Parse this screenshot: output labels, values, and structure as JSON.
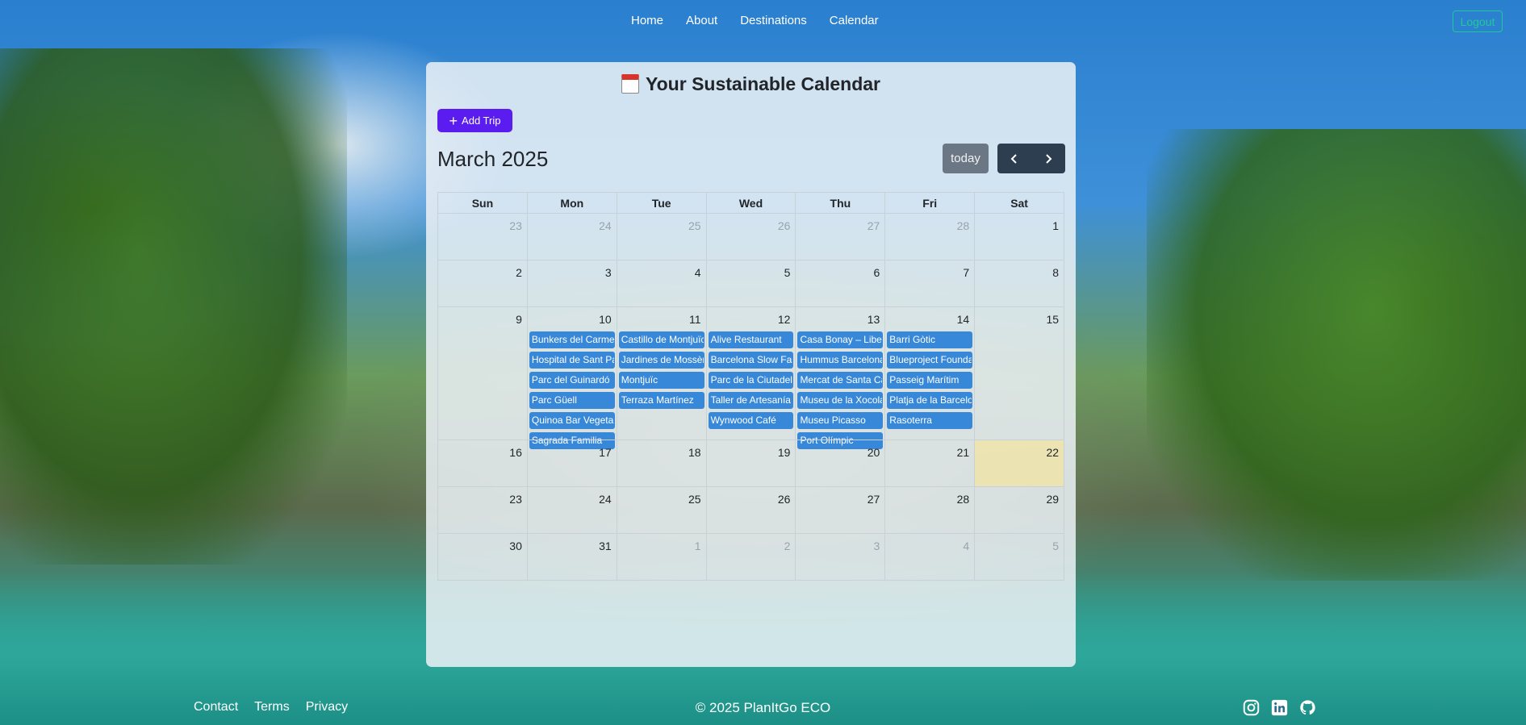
{
  "nav": {
    "links": [
      "Home",
      "About",
      "Destinations",
      "Calendar"
    ],
    "logout": "Logout"
  },
  "card": {
    "title": "Your Sustainable Calendar",
    "add_trip": "Add Trip",
    "month": "March 2025",
    "today": "today"
  },
  "calendar": {
    "weekdays": [
      "Sun",
      "Mon",
      "Tue",
      "Wed",
      "Thu",
      "Fri",
      "Sat"
    ],
    "weeks": [
      [
        {
          "n": "23",
          "other": true
        },
        {
          "n": "24",
          "other": true
        },
        {
          "n": "25",
          "other": true
        },
        {
          "n": "26",
          "other": true
        },
        {
          "n": "27",
          "other": true
        },
        {
          "n": "28",
          "other": true
        },
        {
          "n": "1"
        }
      ],
      [
        {
          "n": "2"
        },
        {
          "n": "3"
        },
        {
          "n": "4"
        },
        {
          "n": "5"
        },
        {
          "n": "6"
        },
        {
          "n": "7"
        },
        {
          "n": "8"
        }
      ],
      [
        {
          "n": "9"
        },
        {
          "n": "10",
          "events": [
            "Bunkers del Carmel",
            "Hospital de Sant Pau",
            "Parc del Guinardó",
            "Parc Güell",
            "Quinoa Bar Vegetariano",
            "Sagrada Familia"
          ]
        },
        {
          "n": "11",
          "events": [
            "Castillo de Montjuïc",
            "Jardines de Mossèn",
            "Montjuïc",
            "Terraza Martínez"
          ]
        },
        {
          "n": "12",
          "events": [
            "Alive Restaurant",
            "Barcelona Slow Fashion",
            "Parc de la Ciutadella",
            "Taller de Artesanía",
            "Wynwood Café"
          ]
        },
        {
          "n": "13",
          "events": [
            "Casa Bonay – Libertine",
            "Hummus Barcelona",
            "Mercat de Santa Caterina",
            "Museu de la Xocolata",
            "Museu Picasso",
            "Port Olímpic"
          ]
        },
        {
          "n": "14",
          "events": [
            "Barri Gòtic",
            "Blueproject Foundation",
            "Passeig Marítim",
            "Platja de la Barceloneta",
            "Rasoterra"
          ]
        },
        {
          "n": "15"
        }
      ],
      [
        {
          "n": "16"
        },
        {
          "n": "17"
        },
        {
          "n": "18"
        },
        {
          "n": "19"
        },
        {
          "n": "20"
        },
        {
          "n": "21"
        },
        {
          "n": "22",
          "today": true
        }
      ],
      [
        {
          "n": "23"
        },
        {
          "n": "24"
        },
        {
          "n": "25"
        },
        {
          "n": "26"
        },
        {
          "n": "27"
        },
        {
          "n": "28"
        },
        {
          "n": "29"
        }
      ],
      [
        {
          "n": "30"
        },
        {
          "n": "31"
        },
        {
          "n": "1",
          "other": true
        },
        {
          "n": "2",
          "other": true
        },
        {
          "n": "3",
          "other": true
        },
        {
          "n": "4",
          "other": true
        },
        {
          "n": "5",
          "other": true
        }
      ]
    ]
  },
  "footer": {
    "links": [
      "Contact",
      "Terms",
      "Privacy"
    ],
    "copyright": "© 2025 PlanItGo ECO",
    "social": [
      "instagram-icon",
      "linkedin-icon",
      "github-icon"
    ]
  },
  "colors": {
    "event": "#3788d8",
    "add_trip": "#5b1cf0",
    "logout": "#20c997",
    "today_highlight": "#fce68c"
  }
}
